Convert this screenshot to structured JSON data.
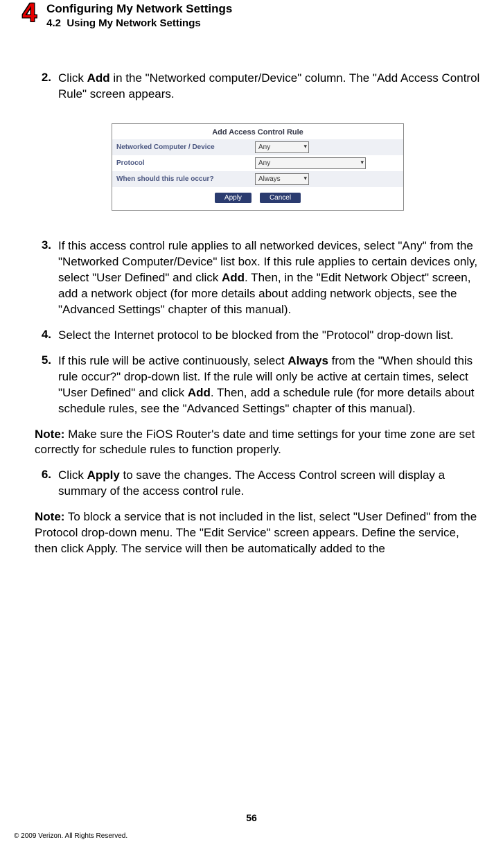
{
  "header": {
    "chapter_number": "4",
    "chapter_title": "Configuring My Network Settings",
    "section_number": "4.2",
    "section_title": "Using My Network Settings"
  },
  "steps": {
    "s2": {
      "num": "2.",
      "pre": "Click ",
      "bold1": "Add",
      "post": " in the \"Networked computer/Device\" column. The \"Add Access Control Rule\" screen appears."
    },
    "s3": {
      "num": "3.",
      "pre": "If this access control rule applies to all networked devices, select \"Any\" from the \"Networked Computer/Device\" list box. If this rule applies to certain devices only, select \"User Defined\" and click ",
      "bold1": "Add",
      "post": ". Then, in the \"Edit Network Object\" screen, add a network object (for more details about adding network objects, see the \"Advanced Settings\" chapter of this manual)."
    },
    "s4": {
      "num": "4.",
      "text": "Select the Internet protocol to be blocked from the \"Protocol\" drop-down list."
    },
    "s5": {
      "num": "5.",
      "pre": "If this rule will be active continuously, select ",
      "bold1": "Always",
      "mid": " from the \"When should this rule occur?\" drop-down list. If the rule will only be active at certain times, select \"User Defined\" and click ",
      "bold2": "Add",
      "post": ". Then, add a schedule rule (for more details about schedule rules, see the \"Advanced Settings\" chapter of this manual)."
    },
    "s6": {
      "num": "6.",
      "pre": "Click ",
      "bold1": "Apply",
      "post": " to save the changes. The Access Control screen will display a summary of the access control rule."
    }
  },
  "notes": {
    "n1": {
      "label": "Note:",
      "text": " Make sure the FiOS Router's date and time settings for your time zone are set correctly for schedule rules to function properly."
    },
    "n2": {
      "label": "Note:",
      "text": " To block a service that is not included in the list, select \"User Defined\" from the Protocol drop-down menu. The \"Edit Service\" screen appears. Define the service, then click Apply. The service will then be automatically added to the"
    }
  },
  "figure": {
    "title": "Add Access Control Rule",
    "row1_label": "Networked Computer / Device",
    "row1_value": "Any",
    "row2_label": "Protocol",
    "row2_value": "Any",
    "row3_label": "When should this rule occur?",
    "row3_value": "Always",
    "btn_apply": "Apply",
    "btn_cancel": "Cancel"
  },
  "footer": {
    "page_number": "56",
    "copyright": "© 2009 Verizon. All Rights Reserved."
  }
}
